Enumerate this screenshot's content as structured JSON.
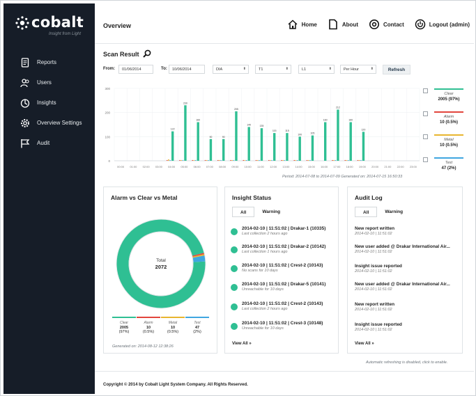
{
  "brand": {
    "name": "cobalt",
    "tagline": "Insight from Light"
  },
  "sidebar": {
    "items": [
      {
        "label": "Reports",
        "icon": "reports-icon"
      },
      {
        "label": "Users",
        "icon": "users-icon"
      },
      {
        "label": "Insights",
        "icon": "insights-icon"
      },
      {
        "label": "Overview Settings",
        "icon": "gear-icon"
      },
      {
        "label": "Audit",
        "icon": "flag-icon"
      }
    ]
  },
  "header": {
    "title": "Overview",
    "nav": [
      {
        "label": "Home",
        "icon": "home-icon"
      },
      {
        "label": "About",
        "icon": "document-icon"
      },
      {
        "label": "Contact",
        "icon": "at-icon"
      },
      {
        "label": "Logout (admin)",
        "icon": "power-icon"
      }
    ]
  },
  "scan": {
    "title": "Scan Result",
    "from_label": "From:",
    "from_value": "01/06/2014",
    "to_label": "To:",
    "to_value": "10/06/2014",
    "select_1": "DIA",
    "select_2": "T1",
    "select_3": "L1",
    "select_4": "Per Hour",
    "refresh_label": "Refresh",
    "period_text": "Period: 2014-07-08 to 2014-07-09 Generated on: 2014-07-15 16:50:33"
  },
  "chart_data": {
    "type": "bar",
    "categories": [
      "00:00",
      "01:00",
      "02:00",
      "03:00",
      "04:00",
      "05:00",
      "06:00",
      "07:00",
      "08:00",
      "09:00",
      "10:00",
      "11:00",
      "12:00",
      "13:00",
      "14:00",
      "15:00",
      "16:00",
      "17:00",
      "18:00",
      "19:00",
      "20:00",
      "21:00",
      "22:00",
      "23:00"
    ],
    "series": [
      {
        "name": "Clear",
        "values": [
          0,
          0,
          0,
          0,
          122,
          230,
          160,
          0,
          0,
          205,
          140,
          135,
          0,
          115,
          100,
          105,
          0,
          212,
          160,
          120,
          0,
          0,
          0,
          0
        ]
      },
      {
        "name": "Alarm",
        "values": [
          0,
          0,
          0,
          0,
          1,
          1,
          1,
          1,
          1,
          1,
          1,
          1,
          1,
          1,
          1,
          1,
          0,
          1,
          1,
          1,
          0,
          0,
          0,
          0
        ]
      },
      {
        "name": "Metal",
        "values": [
          0,
          0,
          0,
          0,
          2,
          1,
          1,
          1,
          1,
          1,
          1,
          1,
          1,
          1,
          1,
          1,
          0,
          1,
          1,
          1,
          0,
          0,
          0,
          0
        ]
      },
      {
        "name": "Test",
        "values": [
          0,
          0,
          0,
          0,
          1,
          1,
          1,
          1,
          1,
          1,
          1,
          1,
          1,
          1,
          1,
          1,
          0,
          1,
          1,
          1,
          0,
          0,
          0,
          0
        ]
      }
    ],
    "ylim": [
      0,
      300
    ],
    "yticks": [
      0,
      100,
      200,
      300
    ],
    "point_labels": {
      "Clear": [
        "",
        "",
        "",
        "",
        "122",
        "230",
        "160",
        "",
        "",
        "205",
        "140",
        "135",
        "",
        "115",
        "100",
        "105",
        "",
        "212",
        "160",
        "120",
        "",
        "",
        "",
        ""
      ]
    },
    "extra_bars": {
      "06:00_second": 160,
      "07:00": 90,
      "08:00": 90,
      "10:00_second": 140,
      "12:00": 115,
      "14:00_second": 100,
      "16:00": 160,
      "17:00": 125,
      "18:00": 62
    }
  },
  "legend": {
    "items": [
      {
        "name": "Clear",
        "value": "2005 (97%)",
        "color": "#2fbf93"
      },
      {
        "name": "Alarm",
        "value": "10 (0.5%)",
        "color": "#e2453c"
      },
      {
        "name": "Metal",
        "value": "10 (0.5%)",
        "color": "#e8b52f"
      },
      {
        "name": "Test",
        "value": "47 (2%)",
        "color": "#3fa6e0"
      }
    ]
  },
  "donut_card": {
    "title": "Alarm vs Clear vs Metal",
    "total_label": "Total",
    "total_value": "2072",
    "slices": [
      {
        "name": "Clear",
        "count": "2005",
        "pct": "(97%)",
        "value": 2005,
        "color": "#2fbf93"
      },
      {
        "name": "Alarm",
        "count": "10",
        "pct": "(0.5%)",
        "value": 10,
        "color": "#e2453c"
      },
      {
        "name": "Metal",
        "count": "10",
        "pct": "(0.5%)",
        "value": 10,
        "color": "#e8b52f"
      },
      {
        "name": "Test",
        "count": "47",
        "pct": "(2%)",
        "value": 47,
        "color": "#3fa6e0"
      }
    ],
    "generated": "Generated on: 2014-08-12 12:38:26"
  },
  "insight_card": {
    "title": "Insight Status",
    "tabs": [
      "All",
      "Warning"
    ],
    "items": [
      {
        "main": "2014-02-10 | 11:51:02 | Drakar-1 (10335)",
        "sub": "Last collection 2 hours ago"
      },
      {
        "main": "2014-02-10 | 11:51:02 | Drakar-2 (10142)",
        "sub": "Last collection 1 hours ago"
      },
      {
        "main": "2014-02-10 | 11:51:02 | Crest-2 (10143)",
        "sub": "No scans for 10 days"
      },
      {
        "main": "2014-02-10 | 11:51:02 | Drakar-5 (10141)",
        "sub": "Unreachable for 10 days"
      },
      {
        "main": "2014-02-10 | 11:51:02 | Crest-2 (10143)",
        "sub": "Last collection 2 hours ago"
      },
      {
        "main": "2014-02-10 | 11:51:02 | Crest-3 (10148)",
        "sub": "Unreachable for 10 days"
      }
    ],
    "view_all": "View All »"
  },
  "audit_card": {
    "title": "Audit Log",
    "tabs": [
      "All",
      "Warning"
    ],
    "items": [
      {
        "main": "New report written",
        "sub": "2014-02-10 | 11:51:02"
      },
      {
        "main": "New user added @ Drakar International Air...",
        "sub": "2014-02-10 | 11:51:02"
      },
      {
        "main": "Insight issue reported",
        "sub": "2014-02-10 | 11:51:02"
      },
      {
        "main": "New user added @ Drakar International Air...",
        "sub": "2014-02-10 | 11:51:02"
      },
      {
        "main": "New report written",
        "sub": "2014-02-10 | 11:51:02"
      },
      {
        "main": "Insight issue reported",
        "sub": "2014-02-10 | 11:51:02"
      }
    ],
    "view_all": "View All »"
  },
  "autorefresh_text": "Automatic refreshing is disabled, click to enable.",
  "footer": {
    "copyright": "Copyright © 2014 by Cobalt Light System Company. All Rights Reserved."
  }
}
